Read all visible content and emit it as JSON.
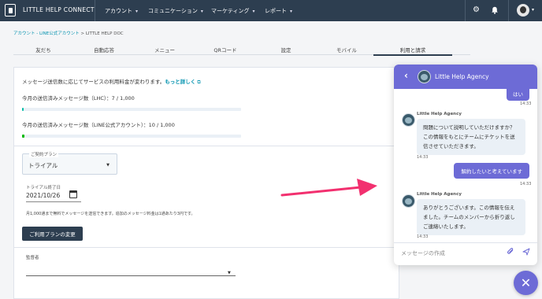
{
  "nav": {
    "brand": "LITTLE HELP CONNECT",
    "items": [
      {
        "label": "アカウント"
      },
      {
        "label": "コミュニケーション"
      },
      {
        "label": "マーケティング"
      },
      {
        "label": "レポート"
      }
    ],
    "icons": [
      "gear-icon",
      "bell-icon",
      "user-avatar"
    ]
  },
  "breadcrumb": {
    "link": "アカウント - LINE公式アカウント",
    "current": " > LITTLE HELP DOC"
  },
  "tabs": [
    {
      "label": "友だち"
    },
    {
      "label": "自動応答"
    },
    {
      "label": "メニュー"
    },
    {
      "label": "QRコード"
    },
    {
      "label": "設定"
    },
    {
      "label": "モバイル"
    },
    {
      "label": "利用と請求",
      "active": true
    }
  ],
  "billing": {
    "notice": "メッセージ送信数に応じてサービスの利用料金が変わります。",
    "notice_link": "もっと詳しく",
    "lhc_label": "今月の送信済みメッセージ数（LHC）：7 / 1,000",
    "lhc_used": 7,
    "lhc_limit": 1000,
    "line_label": "今月の送信済みメッセージ数（LINE公式アカウント）：10 / 1,000",
    "line_used": 10,
    "line_limit": 1000,
    "plan_label": "ご契約プラン",
    "plan_value": "トライアル",
    "trial_end_label": "トライアル終了日",
    "trial_end_value": "2021/10/26",
    "plan_note": "月1,000通まで無料でメッセージを送信できます。追加のメッセージ料金は1通あたり3円です。",
    "change_plan_button": "ご利用プランの変更",
    "supervisor_label": "監督者"
  },
  "chat": {
    "title": "Little Help Agency",
    "messages": [
      {
        "type": "out",
        "text": "はい",
        "time": "14:33"
      },
      {
        "type": "in",
        "sender": "Little Help Agency",
        "text": "問題について説明していただけますか？この情報をもとにチームにチケットを送信させていただきます。",
        "time": "14:33"
      },
      {
        "type": "out",
        "text": "解約したいと考えています",
        "time": "14:33"
      },
      {
        "type": "in",
        "sender": "Little Help Agency",
        "text": "ありがとうございます。この情報を伝えました。チームのメンバーから折り返しご連絡いたします。",
        "time": "14:33"
      }
    ],
    "input_placeholder": "メッセージの作成"
  },
  "colors": {
    "nav_bg": "#2d3e50",
    "chat_accent": "#6d6bd6",
    "link": "#0091ae",
    "arrow": "#f2306f",
    "bar_lhc": "#00bda5",
    "bar_line": "#00b900"
  }
}
